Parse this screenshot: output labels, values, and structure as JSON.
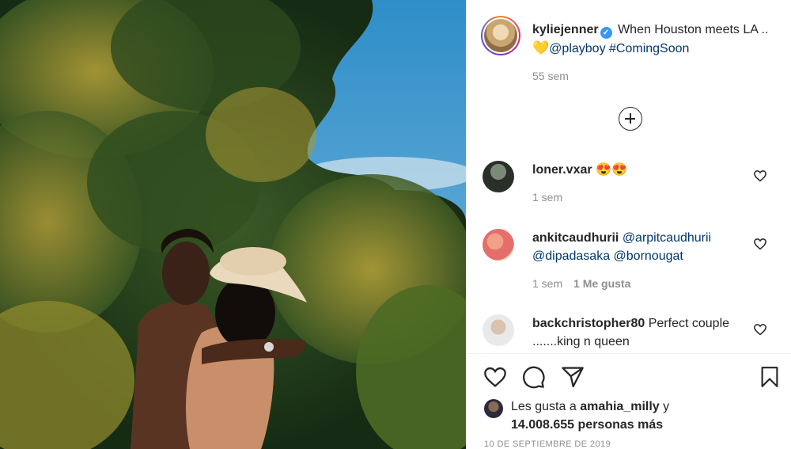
{
  "post": {
    "username": "kyliejenner",
    "caption_text": "When Houston meets LA ..",
    "caption_emoji": "💛",
    "mention": "@playboy",
    "hashtag": "#ComingSoon",
    "time": "55 sem"
  },
  "comments": [
    {
      "username": "loner.vxar",
      "text": "😍😍",
      "time": "1 sem",
      "likes": ""
    },
    {
      "username": "ankitcaudhurii",
      "text": "@arpitcaudhurii @dipadasaka @bornougat",
      "time": "1 sem",
      "likes": "1 Me gusta"
    },
    {
      "username": "backchristopher80",
      "text": "Perfect couple .......king n queen",
      "time": "",
      "likes": ""
    }
  ],
  "likes": {
    "prefix": "Les gusta a",
    "user": "amahia_milly",
    "connector": "y",
    "count": "14.008.655 personas más"
  },
  "date": "10 DE SEPTIEMBRE DE 2019",
  "colors": {
    "link": "#00376b",
    "muted": "#8e8e8e",
    "verified": "#3897f0"
  },
  "icons": [
    "verified-icon",
    "add-comment-icon",
    "heart-icon",
    "comment-icon",
    "share-icon",
    "bookmark-icon"
  ]
}
